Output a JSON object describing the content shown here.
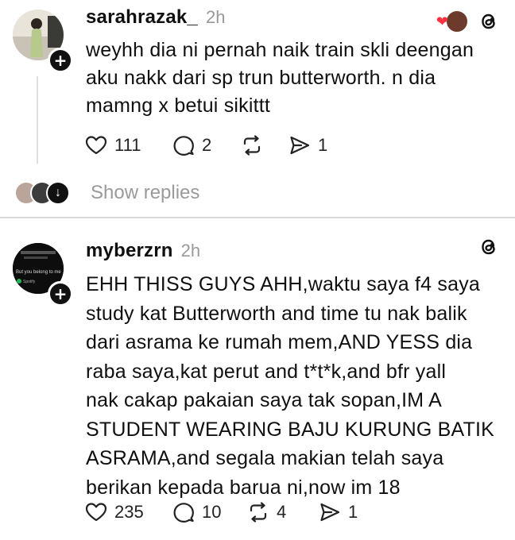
{
  "posts": [
    {
      "username": "sarahrazak_",
      "time": "2h",
      "text": "weyhh dia ni pernah naik train skli deengan\naku  nakk dari sp trun butterworth. n dia\nmamng x betui sikittt",
      "likes": "111",
      "replies": "2",
      "reposts": "",
      "shares": "1",
      "show_replies_label": "Show replies"
    },
    {
      "username": "myberzrn",
      "time": "2h",
      "text": "EHH THISS GUYS AHH,waktu saya f4 saya\nstudy kat Butterworth and time tu nak balik\ndari asrama ke rumah mem,AND YESS dia\nraba saya,kat perut and t*t*k,and bfr yall\nnak cakap pakaian saya tak sopan,IM A\nSTUDENT WEARING BAJU KURUNG BATIK\nASRAMA,and segala makian telah saya\nberikan kepada barua ni,now im 18",
      "likes": "235",
      "replies": "10",
      "reposts": "4",
      "shares": "1",
      "avatar_caption": "But you belong to me",
      "avatar_spotify": "Spotify"
    }
  ],
  "icons": {
    "like": "heart-icon",
    "reply": "comment-icon",
    "repost": "repost-icon",
    "share": "send-icon",
    "threads": "threads-logo-icon",
    "follow": "plus-icon"
  }
}
